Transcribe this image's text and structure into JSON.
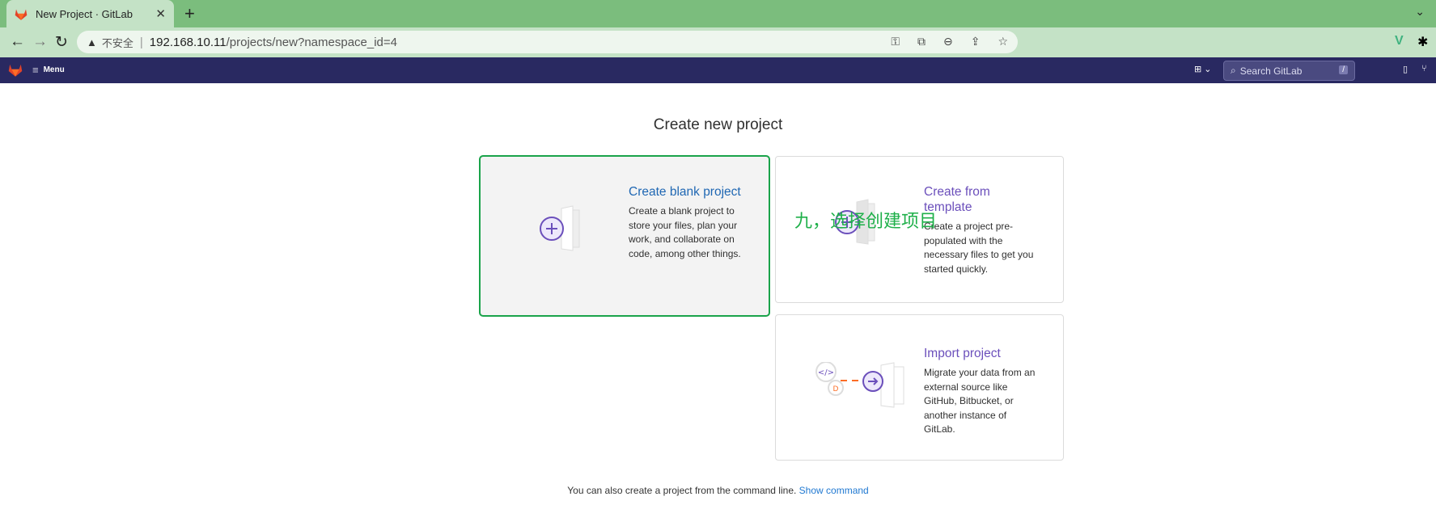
{
  "browser": {
    "tab_title": "New Project · GitLab",
    "url_security": "不安全",
    "url_host": "192.168.10.11",
    "url_path": "/projects/new?namespace_id=4"
  },
  "navbar": {
    "menu_label": "Menu",
    "search_placeholder": "Search GitLab",
    "search_shortcut": "/"
  },
  "page": {
    "title": "Create new project",
    "cards": [
      {
        "title": "Create blank project",
        "description": "Create a blank project to store your files, plan your work, and collaborate on code, among other things.",
        "selected": true
      },
      {
        "title": "Create from template",
        "description": "Create a project pre-populated with the necessary files to get you started quickly."
      },
      {
        "title": "Import project",
        "description": "Migrate your data from an external source like GitHub, Bitbucket, or another instance of GitLab."
      }
    ],
    "footer_text": "You can also create a project from the command line.",
    "footer_link": "Show command"
  },
  "annotation": "九，选择创建项目",
  "colors": {
    "navbar": "#292961",
    "selection": "#1aa34a",
    "accent": "#6b4fbb"
  }
}
